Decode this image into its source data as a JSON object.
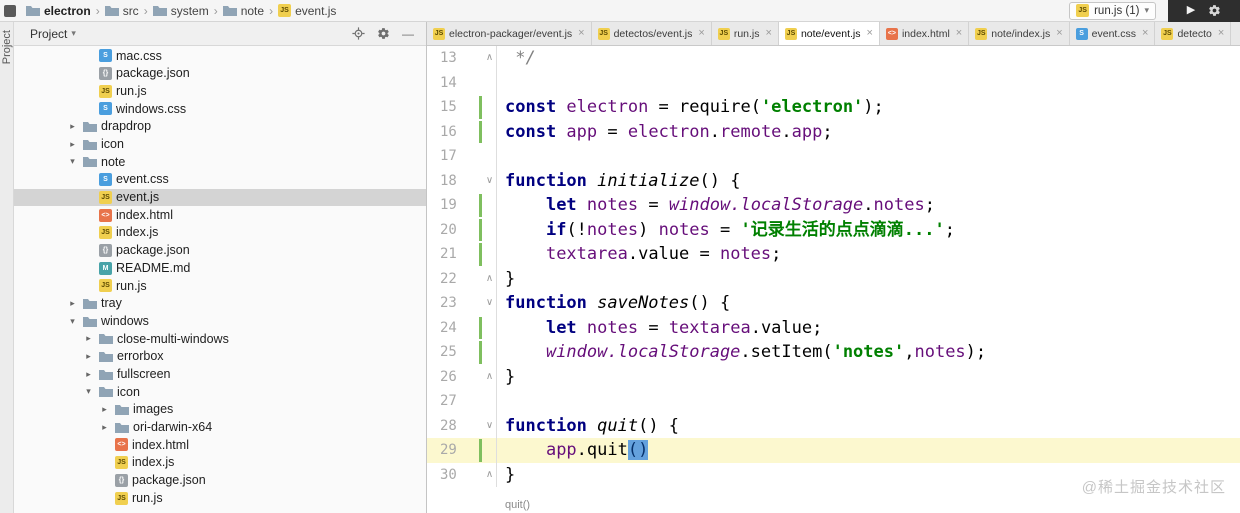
{
  "breadcrumb_bar": {
    "items": [
      {
        "label": "electron",
        "icon": "folder"
      },
      {
        "label": "src",
        "icon": "folder"
      },
      {
        "label": "system",
        "icon": "folder"
      },
      {
        "label": "note",
        "icon": "folder"
      },
      {
        "label": "event.js",
        "icon": "js"
      }
    ],
    "run_config": {
      "label": "run.js (1)",
      "icon": "js"
    }
  },
  "project_panel": {
    "stripe_label": "Project",
    "header": {
      "title": "Project"
    },
    "tree": [
      {
        "label": "mac.css",
        "type": "css",
        "level": 2
      },
      {
        "label": "package.json",
        "type": "json",
        "level": 2
      },
      {
        "label": "run.js",
        "type": "js",
        "level": 2
      },
      {
        "label": "windows.css",
        "type": "css",
        "level": 2
      },
      {
        "label": "drapdrop",
        "type": "folder",
        "level": 1,
        "expanded": false
      },
      {
        "label": "icon",
        "type": "folder",
        "level": 1,
        "expanded": false
      },
      {
        "label": "note",
        "type": "folder",
        "level": 1,
        "expanded": true
      },
      {
        "label": "event.css",
        "type": "css",
        "level": 2
      },
      {
        "label": "event.js",
        "type": "js",
        "level": 2,
        "selected": true
      },
      {
        "label": "index.html",
        "type": "html",
        "level": 2
      },
      {
        "label": "index.js",
        "type": "js",
        "level": 2
      },
      {
        "label": "package.json",
        "type": "json",
        "level": 2
      },
      {
        "label": "README.md",
        "type": "md",
        "level": 2
      },
      {
        "label": "run.js",
        "type": "js",
        "level": 2
      },
      {
        "label": "tray",
        "type": "folder",
        "level": 1,
        "expanded": false
      },
      {
        "label": "windows",
        "type": "folder",
        "level": 1,
        "expanded": true
      },
      {
        "label": "close-multi-windows",
        "type": "folder",
        "level": 2,
        "expanded": false
      },
      {
        "label": "errorbox",
        "type": "folder",
        "level": 2,
        "expanded": false
      },
      {
        "label": "fullscreen",
        "type": "folder",
        "level": 2,
        "expanded": false
      },
      {
        "label": "icon",
        "type": "folder",
        "level": 2,
        "expanded": true
      },
      {
        "label": "images",
        "type": "folder",
        "level": 3,
        "expanded": false
      },
      {
        "label": "ori-darwin-x64",
        "type": "folder",
        "level": 3,
        "expanded": false
      },
      {
        "label": "index.html",
        "type": "html",
        "level": 3
      },
      {
        "label": "index.js",
        "type": "js",
        "level": 3
      },
      {
        "label": "package.json",
        "type": "json",
        "level": 3
      },
      {
        "label": "run.js",
        "type": "js",
        "level": 3
      }
    ]
  },
  "editor": {
    "tabs": [
      {
        "label": "electron-packager/event.js",
        "type": "js",
        "active": false
      },
      {
        "label": "detectos/event.js",
        "type": "js",
        "active": false
      },
      {
        "label": "run.js",
        "type": "js",
        "active": false
      },
      {
        "label": "note/event.js",
        "type": "js",
        "active": true
      },
      {
        "label": "index.html",
        "type": "html",
        "active": false
      },
      {
        "label": "note/index.js",
        "type": "js",
        "active": false
      },
      {
        "label": "event.css",
        "type": "css",
        "active": false
      },
      {
        "label": "detecto",
        "type": "js",
        "active": false
      }
    ],
    "lines": [
      {
        "n": 13,
        "fold": "up",
        "seg": [
          [
            "c",
            " */"
          ]
        ]
      },
      {
        "n": 14,
        "seg": []
      },
      {
        "n": 15,
        "changed": true,
        "seg": [
          [
            "k",
            "const "
          ],
          [
            "v",
            "electron"
          ],
          [
            "p",
            " = "
          ],
          [
            "p",
            "require"
          ],
          [
            "p",
            "("
          ],
          [
            "s",
            "'electron'"
          ],
          [
            "p",
            ");"
          ]
        ]
      },
      {
        "n": 16,
        "changed": true,
        "seg": [
          [
            "k",
            "const "
          ],
          [
            "v",
            "app"
          ],
          [
            "p",
            " = "
          ],
          [
            "v",
            "electron"
          ],
          [
            "p",
            "."
          ],
          [
            "v",
            "remote"
          ],
          [
            "p",
            "."
          ],
          [
            "v",
            "app"
          ],
          [
            "p",
            ";"
          ]
        ]
      },
      {
        "n": 17,
        "seg": []
      },
      {
        "n": 18,
        "fold": "down",
        "seg": [
          [
            "k",
            "function "
          ],
          [
            "fn",
            "initialize"
          ],
          [
            "p",
            "() {"
          ]
        ]
      },
      {
        "n": 19,
        "changed": true,
        "seg": [
          [
            "p",
            "    "
          ],
          [
            "k",
            "let "
          ],
          [
            "v",
            "notes"
          ],
          [
            "p",
            " = "
          ],
          [
            "vi",
            "window.localStorage"
          ],
          [
            "p",
            "."
          ],
          [
            "v",
            "notes"
          ],
          [
            "p",
            ";"
          ]
        ]
      },
      {
        "n": 20,
        "changed": true,
        "seg": [
          [
            "p",
            "    "
          ],
          [
            "k",
            "if"
          ],
          [
            "p",
            "(!"
          ],
          [
            "v",
            "notes"
          ],
          [
            "p",
            ") "
          ],
          [
            "v",
            "notes"
          ],
          [
            "p",
            " = "
          ],
          [
            "s",
            "'记录生活的点点滴滴...'"
          ],
          [
            "p",
            ";"
          ]
        ]
      },
      {
        "n": 21,
        "changed": true,
        "seg": [
          [
            "p",
            "    "
          ],
          [
            "v",
            "textarea"
          ],
          [
            "p",
            ".value = "
          ],
          [
            "v",
            "notes"
          ],
          [
            "p",
            ";"
          ]
        ]
      },
      {
        "n": 22,
        "fold": "up",
        "seg": [
          [
            "p",
            "}"
          ]
        ]
      },
      {
        "n": 23,
        "fold": "down",
        "seg": [
          [
            "k",
            "function "
          ],
          [
            "fn",
            "saveNotes"
          ],
          [
            "p",
            "() {"
          ]
        ]
      },
      {
        "n": 24,
        "changed": true,
        "seg": [
          [
            "p",
            "    "
          ],
          [
            "k",
            "let "
          ],
          [
            "v",
            "notes"
          ],
          [
            "p",
            " = "
          ],
          [
            "v",
            "textarea"
          ],
          [
            "p",
            ".value;"
          ]
        ]
      },
      {
        "n": 25,
        "changed": true,
        "seg": [
          [
            "p",
            "    "
          ],
          [
            "vi",
            "window.localStorage"
          ],
          [
            "p",
            "."
          ],
          [
            "p",
            "setItem"
          ],
          [
            "p",
            "("
          ],
          [
            "s",
            "'notes'"
          ],
          [
            "p",
            ","
          ],
          [
            "v",
            "notes"
          ],
          [
            "p",
            ");"
          ]
        ]
      },
      {
        "n": 26,
        "fold": "up",
        "seg": [
          [
            "p",
            "}"
          ]
        ]
      },
      {
        "n": 27,
        "seg": []
      },
      {
        "n": 28,
        "fold": "down",
        "seg": [
          [
            "k",
            "function "
          ],
          [
            "fn",
            "quit"
          ],
          [
            "p",
            "() {"
          ]
        ]
      },
      {
        "n": 29,
        "changed": true,
        "highlight": true,
        "seg": [
          [
            "p",
            "    "
          ],
          [
            "v",
            "app"
          ],
          [
            "p",
            "."
          ],
          [
            "p",
            "quit"
          ],
          [
            "sel",
            "()"
          ]
        ]
      },
      {
        "n": 30,
        "fold": "up",
        "seg": [
          [
            "p",
            "}"
          ]
        ]
      }
    ],
    "context_hint": "quit()"
  },
  "watermark": "@稀土掘金技术社区",
  "colors": {
    "current_line_highlight": "#fcf8cf",
    "selection": "#64a1dd",
    "vcs_change": "#7fbf5f",
    "keyword": "#000080",
    "string": "#008000",
    "identifier": "#660e7a"
  }
}
